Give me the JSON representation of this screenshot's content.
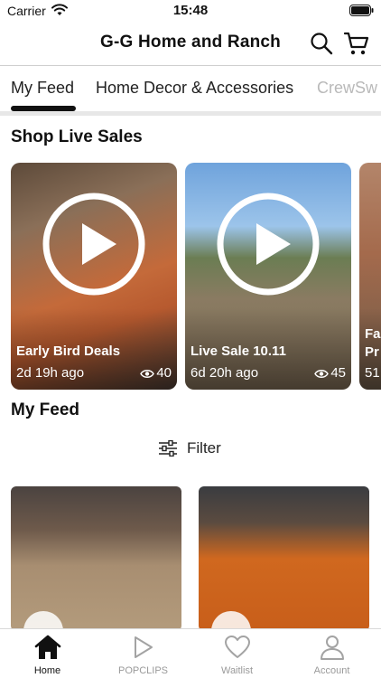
{
  "status_bar": {
    "carrier": "Carrier",
    "time": "15:48"
  },
  "header": {
    "title": "G-G Home and Ranch",
    "icons": [
      "search-icon",
      "cart-icon"
    ]
  },
  "tabs": [
    {
      "label": "My Feed",
      "active": true
    },
    {
      "label": "Home Decor & Accessories",
      "active": false
    },
    {
      "label": "CrewSw",
      "active": false
    }
  ],
  "live_sales": {
    "title": "Shop Live Sales",
    "cards": [
      {
        "title": "Early Bird Deals",
        "time": "2d 19h ago",
        "views": "40"
      },
      {
        "title": "Live Sale 10.11",
        "time": "6d 20h ago",
        "views": "45"
      },
      {
        "title": "Fa Pr",
        "time": "51",
        "views": ""
      }
    ]
  },
  "feed": {
    "title": "My Feed",
    "filter_label": "Filter"
  },
  "bottom_nav": [
    {
      "label": "Home",
      "icon": "home-icon",
      "active": true
    },
    {
      "label": "POPCLIPS",
      "icon": "play-icon",
      "active": false
    },
    {
      "label": "Waitlist",
      "icon": "heart-icon",
      "active": false
    },
    {
      "label": "Account",
      "icon": "account-icon",
      "active": false
    }
  ],
  "colors": {
    "text": "#111111",
    "muted": "#9a9a9a",
    "divider": "#e7e7e7"
  }
}
